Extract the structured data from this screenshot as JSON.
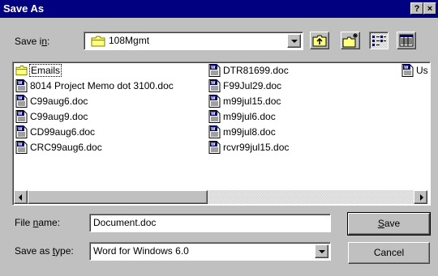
{
  "window": {
    "title": "Save As",
    "help_btn": "?",
    "close_btn": "×"
  },
  "toolbar": {
    "save_in_label_pre": "Save i",
    "save_in_label_u": "n",
    "save_in_label_post": ":",
    "folder": "108Mgmt",
    "buttons": [
      "up-one-level-icon",
      "create-new-folder-icon",
      "list-view-icon",
      "details-view-icon"
    ]
  },
  "files": {
    "col1": [
      {
        "name": "Emails",
        "type": "folder"
      },
      {
        "name": "8014 Project Memo dot 3100.doc",
        "type": "doc"
      },
      {
        "name": "C99aug6.doc",
        "type": "doc"
      },
      {
        "name": "C99aug9.doc",
        "type": "doc"
      },
      {
        "name": "CD99aug6.doc",
        "type": "doc"
      },
      {
        "name": "CRC99aug6.doc",
        "type": "doc"
      }
    ],
    "col2": [
      {
        "name": "DTR81699.doc",
        "type": "doc"
      },
      {
        "name": "F99Jul29.doc",
        "type": "doc"
      },
      {
        "name": "m99jul15.doc",
        "type": "doc"
      },
      {
        "name": "m99jul6.doc",
        "type": "doc"
      },
      {
        "name": "m99jul8.doc",
        "type": "doc"
      },
      {
        "name": "rcvr99jul15.doc",
        "type": "doc"
      }
    ],
    "col3": [
      {
        "name": "Us",
        "type": "doc"
      }
    ]
  },
  "filename": {
    "label_pre": "File ",
    "label_u": "n",
    "label_post": "ame:",
    "value": "Document.doc"
  },
  "filetype": {
    "label_pre": "Save as ",
    "label_u": "t",
    "label_post": "ype:",
    "value": "Word for Windows 6.0"
  },
  "buttons": {
    "save_u": "S",
    "save_rest": "ave",
    "cancel": "Cancel"
  }
}
